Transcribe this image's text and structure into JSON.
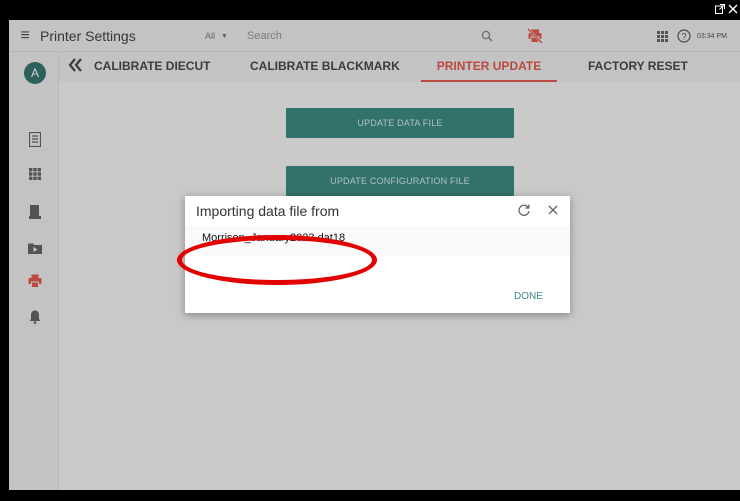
{
  "app": {
    "title": "Printer Settings",
    "filter": "All",
    "search_placeholder": "Search",
    "clock": "03:34 PM",
    "avatar_initial": "A"
  },
  "icons": {
    "menu": "menu-icon",
    "search": "search-icon",
    "printer_off": "printer-off-icon",
    "apps": "apps-grid-icon",
    "help": "help-icon",
    "popout": "popout-icon",
    "close_window": "close-window-icon",
    "back": "double-chevron-left-icon",
    "refresh": "refresh-icon",
    "close": "close-icon"
  },
  "sidebar": {
    "items": [
      {
        "name": "document-icon",
        "active": false
      },
      {
        "name": "grid-icon",
        "active": false
      },
      {
        "name": "device-icon",
        "active": false
      },
      {
        "name": "folder-play-icon",
        "active": false
      },
      {
        "name": "printer-icon",
        "active": true
      },
      {
        "name": "bell-icon",
        "active": false
      }
    ]
  },
  "tabs": {
    "items": [
      "CALIBRATE DIECUT",
      "CALIBRATE BLACKMARK",
      "PRINTER UPDATE",
      "FACTORY RESET"
    ],
    "active": "PRINTER UPDATE"
  },
  "main": {
    "update_data_file": "UPDATE DATA FILE",
    "update_configuration_file": "UPDATE CONFIGURATION FILE"
  },
  "dialog": {
    "title": "Importing data file from",
    "file_name": "Morrison_January2023.dat18",
    "done_label": "DONE"
  },
  "colors": {
    "accent": "#e65a50",
    "teal": "#3f8b84",
    "annotation": "#e30000"
  }
}
